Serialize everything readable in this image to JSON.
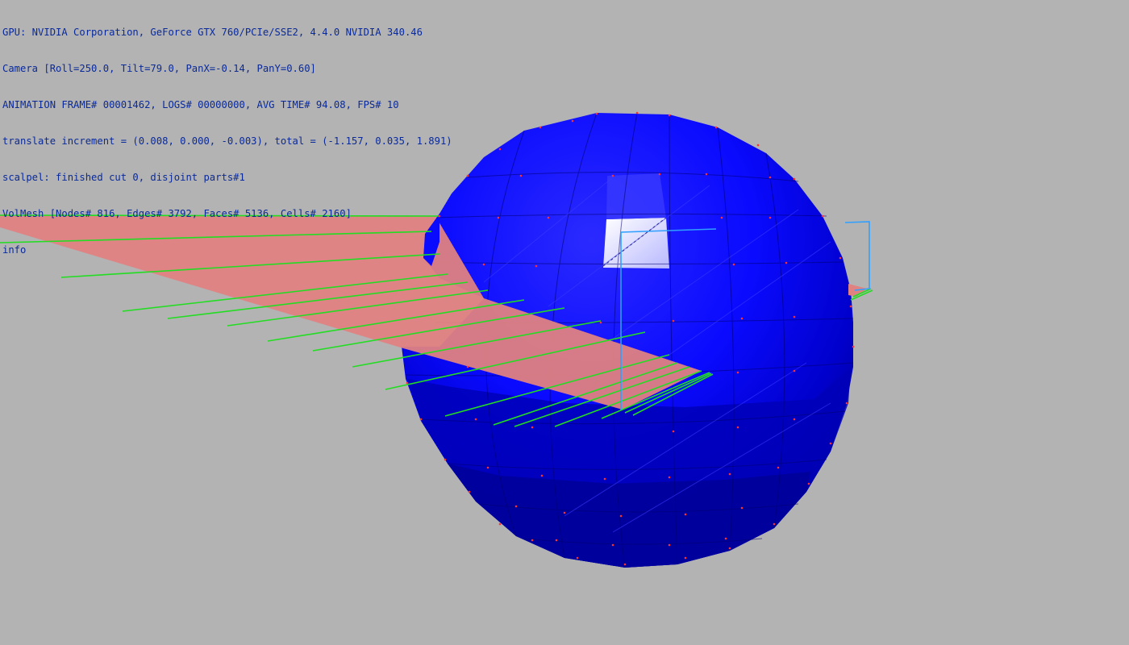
{
  "hud": {
    "lines": [
      "GPU: NVIDIA Corporation, GeForce GTX 760/PCIe/SSE2, 4.4.0 NVIDIA 340.46",
      "Camera [Roll=250.0, Tilt=79.0, PanX=-0.14, PanY=0.60]",
      "ANIMATION FRAME# 00001462, LOGS# 00000000, AVG TIME# 94.08, FPS# 10",
      "translate increment = (0.008, 0.000, -0.003), total = (-1.157, 0.035, 1.891)",
      "scalpel: finished cut 0, disjoint parts#1",
      "VolMesh [Nodes# 816, Edges# 3792, Faces# 5136, Cells# 2160]",
      "info"
    ]
  },
  "scene": {
    "background_color": "#b3b3b3",
    "text_color": "#0a2a9a",
    "sphere_color": "#0a0aff",
    "sphere_shadow_color": "#0000a8",
    "highlight_color": "#c8c8ff",
    "node_color": "#ff3030",
    "cut_plane_color": "#e08282",
    "scalpel_line_color": "#22dd22",
    "frame_color": "#2fa0ff"
  }
}
